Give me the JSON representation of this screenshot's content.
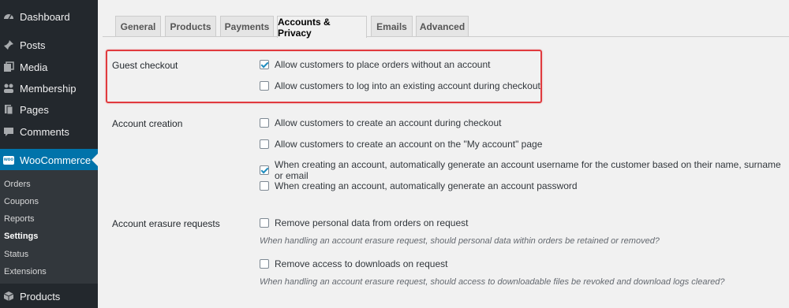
{
  "sidebar": {
    "dashboard": "Dashboard",
    "posts": "Posts",
    "media": "Media",
    "membership": "Membership",
    "pages": "Pages",
    "comments": "Comments",
    "woocommerce": "WooCommerce",
    "woo_badge": "woo",
    "submenu": [
      "Orders",
      "Coupons",
      "Reports",
      "Settings",
      "Status",
      "Extensions"
    ],
    "products": "Products"
  },
  "tabs": [
    "General",
    "Products",
    "Payments",
    "Accounts & Privacy",
    "Emails",
    "Advanced"
  ],
  "sections": {
    "guest_checkout": {
      "label": "Guest checkout",
      "options": [
        {
          "label": "Allow customers to place orders without an account",
          "checked": true
        },
        {
          "label": "Allow customers to log into an existing account during checkout",
          "checked": false
        }
      ]
    },
    "account_creation": {
      "label": "Account creation",
      "options": [
        {
          "label": "Allow customers to create an account during checkout",
          "checked": false
        },
        {
          "label": "Allow customers to create an account on the \"My account\" page",
          "checked": false
        },
        {
          "label": "When creating an account, automatically generate an account username for the customer based on their name, surname or email",
          "checked": true
        },
        {
          "label": "When creating an account, automatically generate an account password",
          "checked": false
        }
      ]
    },
    "erasure": {
      "label": "Account erasure requests",
      "options": [
        {
          "label": "Remove personal data from orders on request",
          "checked": false,
          "desc": "When handling an account erasure request, should personal data within orders be retained or removed?"
        },
        {
          "label": "Remove access to downloads on request",
          "checked": false,
          "desc": "When handling an account erasure request, should access to downloadable files be revoked and download logs cleared?"
        }
      ]
    }
  },
  "colors": {
    "sidebar": "#23282d",
    "active": "#0073aa",
    "highlight": "#e03a3e"
  }
}
